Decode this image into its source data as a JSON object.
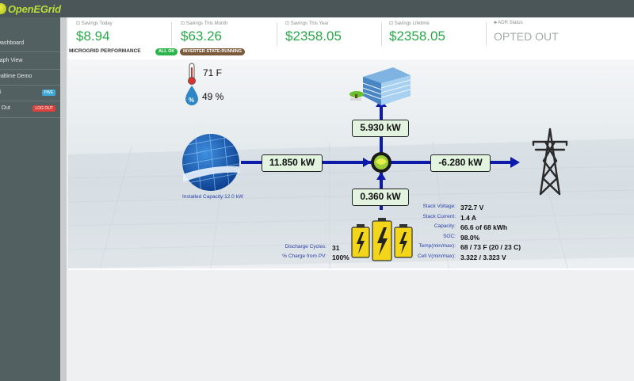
{
  "app": {
    "logo_text": "OpenEGrid"
  },
  "sidebar": {
    "items": [
      {
        "label": "Dashboard"
      },
      {
        "label": "Graph View"
      },
      {
        "label": "Realtime Demo"
      },
      {
        "label": "S",
        "pill": "PWE"
      },
      {
        "label": "Log Out",
        "pill": "LOG OUT"
      }
    ]
  },
  "stats": [
    {
      "title": "⊡ Savings Today",
      "value": "$8.94"
    },
    {
      "title": "⊡ Savings This Month",
      "value": "$63.26"
    },
    {
      "title": "⊡ Savings This Year",
      "value": "$2358.05"
    },
    {
      "title": "⊡ Savings Lifetime",
      "value": "$2358.05"
    },
    {
      "title": "♣ ADR Status",
      "value": "OPTED OUT"
    }
  ],
  "panel": {
    "title": "MICROGRID PERFORMANCE",
    "badge_ok": "ALL OK",
    "badge_inverter": "INVERTER STATE:RUNNING"
  },
  "weather": {
    "temperature": "71 F",
    "humidity": "49 %"
  },
  "flows": {
    "solar": "11.850 kW",
    "building": "5.930 kW",
    "grid": "-6.280 kW",
    "battery": "0.360 kW"
  },
  "solar": {
    "capacity_label": "Installed Capacity:12.0 kW"
  },
  "battery_stats": [
    {
      "key": "Stack Voltage:",
      "value": "372.7 V"
    },
    {
      "key": "Stack Current:",
      "value": "1.4 A"
    },
    {
      "key": "Capacity:",
      "value": "66.6 of 68 kWh"
    },
    {
      "key": "SOC:",
      "value": "98.0%"
    },
    {
      "key": "Temp(min/max):",
      "value": "68 / 73 F (20 / 23 C)"
    },
    {
      "key": "Cell V(min/max):",
      "value": "3.322 / 3.323 V"
    }
  ],
  "battery_left": [
    {
      "key": "Discharge Cycles:",
      "value": "31"
    },
    {
      "key": "% Charge from PV:",
      "value": "100%"
    }
  ],
  "colors": {
    "accent_green": "#29a84a",
    "flow_blue": "#0b1aa8",
    "badge_green": "#2bb44a",
    "badge_brown": "#7a5a3a"
  }
}
